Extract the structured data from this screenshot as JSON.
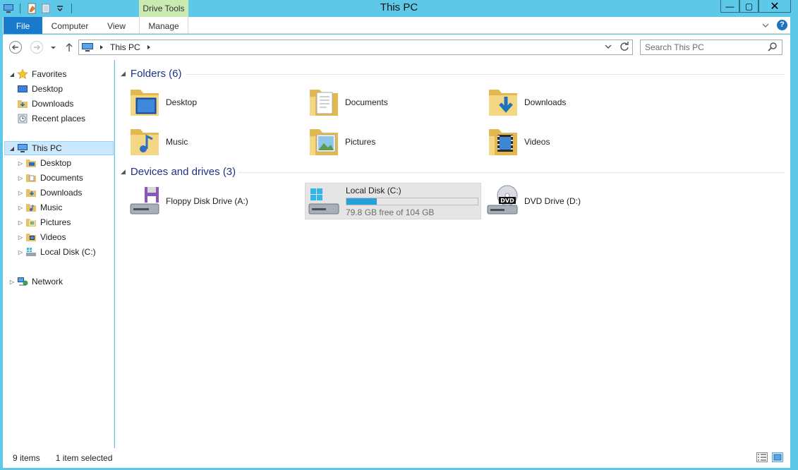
{
  "window": {
    "title": "This PC",
    "context_tab": "Drive Tools",
    "controls": {
      "minimize": "—",
      "maximize": "▢",
      "close": "✕"
    }
  },
  "ribbon": {
    "tabs": [
      {
        "label": "File",
        "active": true
      },
      {
        "label": "Computer"
      },
      {
        "label": "View"
      },
      {
        "label": "Manage"
      }
    ],
    "help": "?"
  },
  "navbar": {
    "breadcrumb": [
      "This PC"
    ],
    "search_placeholder": "Search This PC"
  },
  "navpane": {
    "favorites": {
      "label": "Favorites",
      "items": [
        {
          "label": "Desktop",
          "icon": "desktop-icon"
        },
        {
          "label": "Downloads",
          "icon": "downloads-icon"
        },
        {
          "label": "Recent places",
          "icon": "recent-places-icon"
        }
      ]
    },
    "this_pc": {
      "label": "This PC",
      "items": [
        {
          "label": "Desktop",
          "icon": "desktop-folder-icon"
        },
        {
          "label": "Documents",
          "icon": "documents-folder-icon"
        },
        {
          "label": "Downloads",
          "icon": "downloads-folder-icon"
        },
        {
          "label": "Music",
          "icon": "music-folder-icon"
        },
        {
          "label": "Pictures",
          "icon": "pictures-folder-icon"
        },
        {
          "label": "Videos",
          "icon": "videos-folder-icon"
        },
        {
          "label": "Local Disk (C:)",
          "icon": "local-disk-icon"
        }
      ]
    },
    "network": {
      "label": "Network"
    }
  },
  "content": {
    "folders_header": "Folders (6)",
    "folders": [
      {
        "label": "Desktop",
        "icon": "desktop-folder-icon"
      },
      {
        "label": "Documents",
        "icon": "documents-folder-icon"
      },
      {
        "label": "Downloads",
        "icon": "downloads-folder-icon"
      },
      {
        "label": "Music",
        "icon": "music-folder-icon"
      },
      {
        "label": "Pictures",
        "icon": "pictures-folder-icon"
      },
      {
        "label": "Videos",
        "icon": "videos-folder-icon"
      }
    ],
    "devices_header": "Devices and drives (3)",
    "devices": [
      {
        "label": "Floppy Disk Drive (A:)",
        "icon": "floppy-drive-icon"
      },
      {
        "label": "Local Disk (C:)",
        "icon": "local-disk-icon",
        "free_text": "79.8 GB free of 104 GB",
        "used_fraction": 0.233,
        "selected": true
      },
      {
        "label": "DVD Drive (D:)",
        "icon": "dvd-drive-icon"
      }
    ]
  },
  "status": {
    "items": "9 items",
    "selected": "1 item selected"
  },
  "colors": {
    "frame": "#5dc8e8",
    "accent": "#1979ca",
    "header_text": "#1e3287",
    "selection": "#cce8ff"
  }
}
